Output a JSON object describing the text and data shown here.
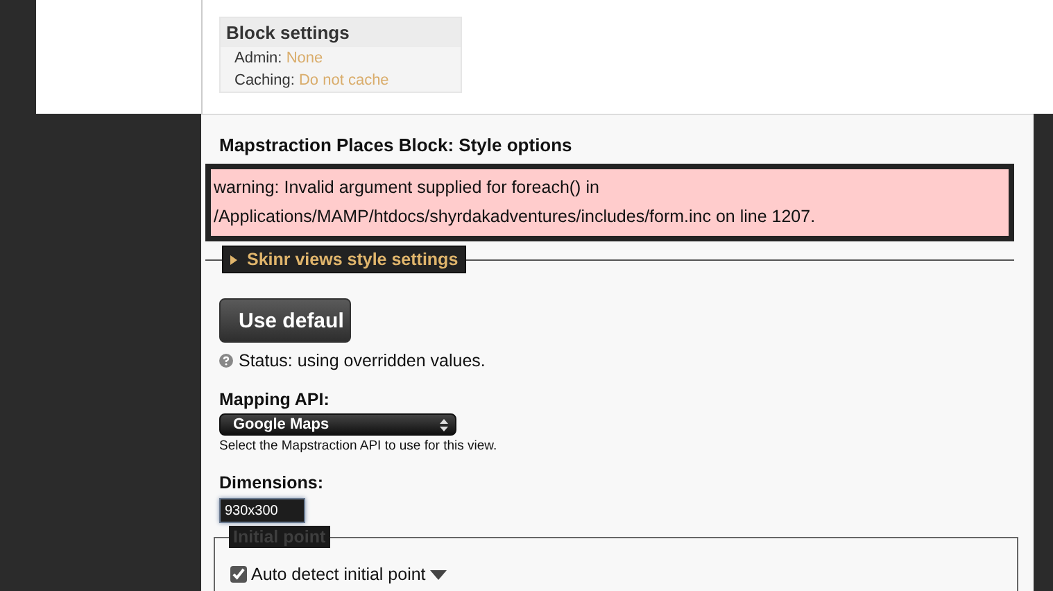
{
  "block_settings": {
    "title": "Block settings",
    "rows": [
      {
        "label": "Admin:",
        "value": "None"
      },
      {
        "label": "Caching:",
        "value": "Do not cache"
      }
    ]
  },
  "style_options": {
    "title": "Mapstraction Places Block: Style options",
    "warning": {
      "line_1": "warning: Invalid argument supplied for foreach() in",
      "line_2": "/Applications/MAMP/htdocs/shyrdakadventures/includes/form.inc on line 1207."
    },
    "skinr": {
      "legend": "Skinr views style settings",
      "expanded": false
    },
    "use_default_button": "Use defaul",
    "status": "Status: using overridden values.",
    "mapping_api": {
      "label": "Mapping API:",
      "value": "Google Maps",
      "description": "Select the Mapstraction API to use for this view."
    },
    "dimensions": {
      "label": "Dimensions:",
      "value": "930x300"
    },
    "initial_point": {
      "legend": "Initial point",
      "auto_detect": {
        "label": "Auto detect initial point",
        "checked": true
      }
    }
  }
}
